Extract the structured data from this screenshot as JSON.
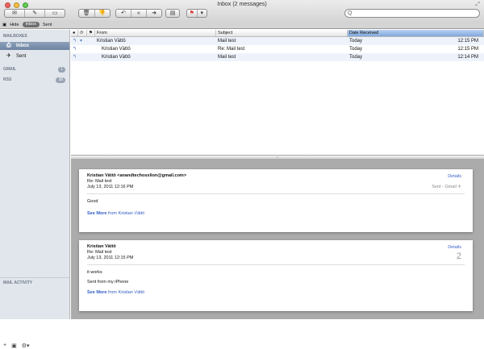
{
  "window": {
    "title": "Inbox (2 messages)"
  },
  "toolbar": {
    "search_placeholder": "Q"
  },
  "favorites": {
    "hide": "Hide",
    "inbox": "Inbox",
    "sent": "Sent"
  },
  "sidebar": {
    "mailboxes_header": "MAILBOXES",
    "items": [
      {
        "label": "Inbox",
        "icon": "inbox-icon"
      },
      {
        "label": "Sent",
        "icon": "sent-icon"
      }
    ],
    "gmail_header": "GMAIL",
    "gmail_badge": "1",
    "rss_header": "RSS",
    "rss_badge": "38",
    "activity": "MAIL ACTIVITY",
    "bottom": {
      "add": "+",
      "mailbox": "▣",
      "gear": "⚙▾"
    }
  },
  "list": {
    "columns": {
      "from": "From",
      "subject": "Subject",
      "date": "Date Received"
    },
    "rows": [
      {
        "from": "Kristian Vättö",
        "subject": "Mail test",
        "date": "Today",
        "time": "12:15 PM",
        "thread": true
      },
      {
        "from": "Kristian Vättö",
        "subject": "Re: Mail test",
        "date": "Today",
        "time": "12:15 PM",
        "thread": false
      },
      {
        "from": "Kristian Vättö",
        "subject": "Mail test",
        "date": "Today",
        "time": "12:14 PM",
        "thread": false
      }
    ]
  },
  "messages": [
    {
      "from": "Kristian Vättö <anandtechosxlion@gmail.com>",
      "subject": "Re: Mail test",
      "date": "July 13, 2011 12:16 PM",
      "details": "Details",
      "account": "Sent - Gmail",
      "body": [
        "Good"
      ],
      "see_more": "See More",
      "see_more_from": "from Kristian Vättö"
    },
    {
      "from": "Kristian Vättö",
      "subject": "Re: Mail test",
      "date": "July 13, 2011 12:15 PM",
      "details": "Details",
      "number": "2",
      "body": [
        "it works",
        "Sent from my iPhone"
      ],
      "see_more": "See More",
      "see_more_from": "from Kristian Vättö"
    }
  ],
  "colors": {
    "selection": "#80a9dd",
    "link": "#2f5bc3",
    "sidebar": "#e1e6ec"
  }
}
